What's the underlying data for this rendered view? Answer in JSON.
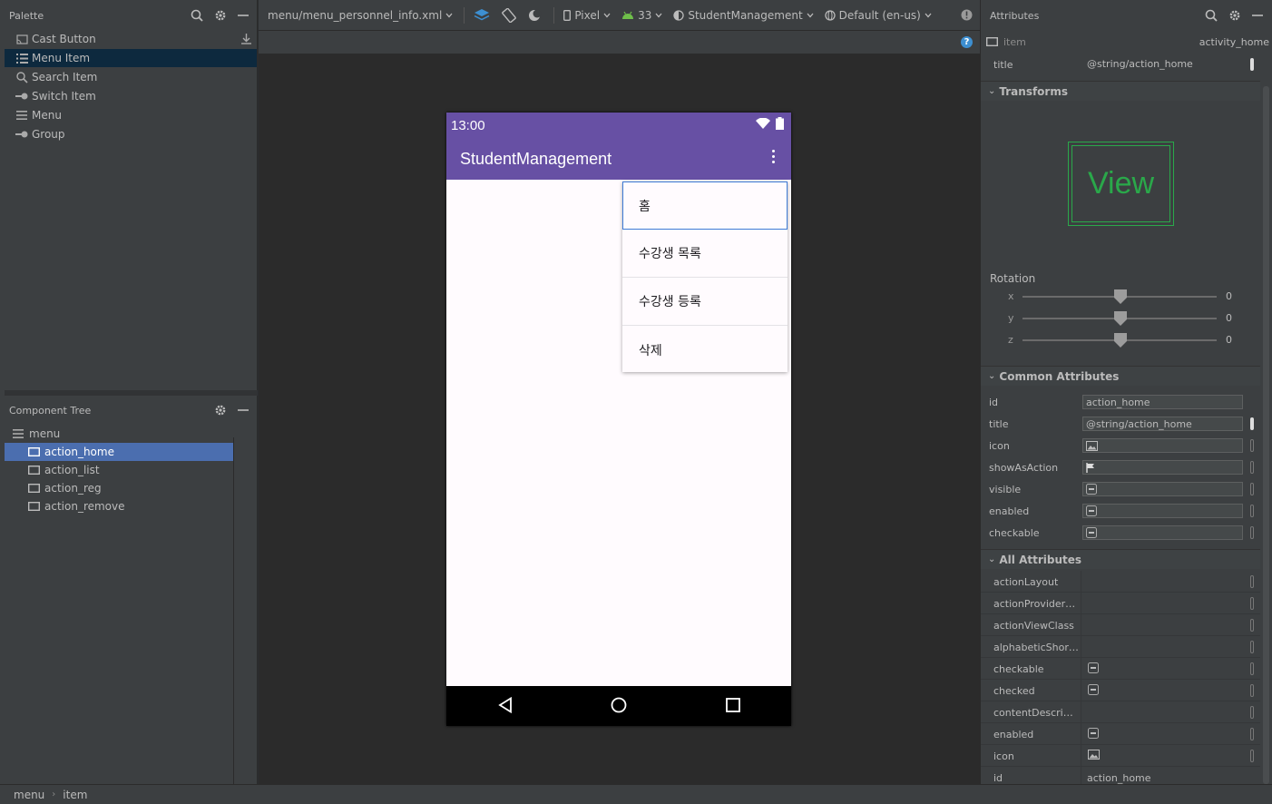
{
  "palette": {
    "title": "Palette",
    "items": [
      {
        "label": "Cast Button",
        "icon": "cast-icon"
      },
      {
        "label": "Menu Item",
        "icon": "menu-item-icon",
        "selected": true
      },
      {
        "label": "Search Item",
        "icon": "search-icon"
      },
      {
        "label": "Switch Item",
        "icon": "switch-icon"
      },
      {
        "label": "Menu",
        "icon": "menu-icon"
      },
      {
        "label": "Group",
        "icon": "group-icon"
      }
    ]
  },
  "component_tree": {
    "title": "Component Tree",
    "root": "menu",
    "items": [
      {
        "label": "action_home",
        "selected": true
      },
      {
        "label": "action_list"
      },
      {
        "label": "action_reg"
      },
      {
        "label": "action_remove"
      }
    ]
  },
  "toolbar": {
    "file": "menu/menu_personnel_info.xml",
    "device": "Pixel",
    "api": "33",
    "theme": "StudentManagement",
    "locale": "Default (en-us)"
  },
  "help_label": "?",
  "phone": {
    "time": "13:00",
    "app_title": "StudentManagement",
    "menu_items": [
      "홈",
      "수강생 목록",
      "수강생 등록",
      "삭제"
    ],
    "primary_color": "#6750a4"
  },
  "attributes": {
    "title": "Attributes",
    "item_type": "item",
    "item_id": "activity_home",
    "top_row": {
      "label": "title",
      "value": "@string/action_home"
    },
    "transforms_label": "Transforms",
    "view_label": "View",
    "rotation_label": "Rotation",
    "rotation": [
      {
        "axis": "x",
        "value": "0"
      },
      {
        "axis": "y",
        "value": "0"
      },
      {
        "axis": "z",
        "value": "0"
      }
    ],
    "common_label": "Common Attributes",
    "common": [
      {
        "label": "id",
        "value": "action_home"
      },
      {
        "label": "title",
        "value": "@string/action_home"
      },
      {
        "label": "icon",
        "value": ""
      },
      {
        "label": "showAsAction",
        "value": ""
      },
      {
        "label": "visible",
        "value": ""
      },
      {
        "label": "enabled",
        "value": ""
      },
      {
        "label": "checkable",
        "value": ""
      }
    ],
    "all_label": "All Attributes",
    "all": [
      {
        "label": "actionLayout",
        "value": ""
      },
      {
        "label": "actionProviderCl...",
        "value": ""
      },
      {
        "label": "actionViewClass",
        "value": ""
      },
      {
        "label": "alphabeticShortc...",
        "value": ""
      },
      {
        "label": "checkable",
        "value": ""
      },
      {
        "label": "checked",
        "value": ""
      },
      {
        "label": "contentDescripti...",
        "value": ""
      },
      {
        "label": "enabled",
        "value": ""
      },
      {
        "label": "icon",
        "value": ""
      },
      {
        "label": "id",
        "value": "action_home"
      }
    ]
  },
  "breadcrumb": [
    "menu",
    "item"
  ]
}
